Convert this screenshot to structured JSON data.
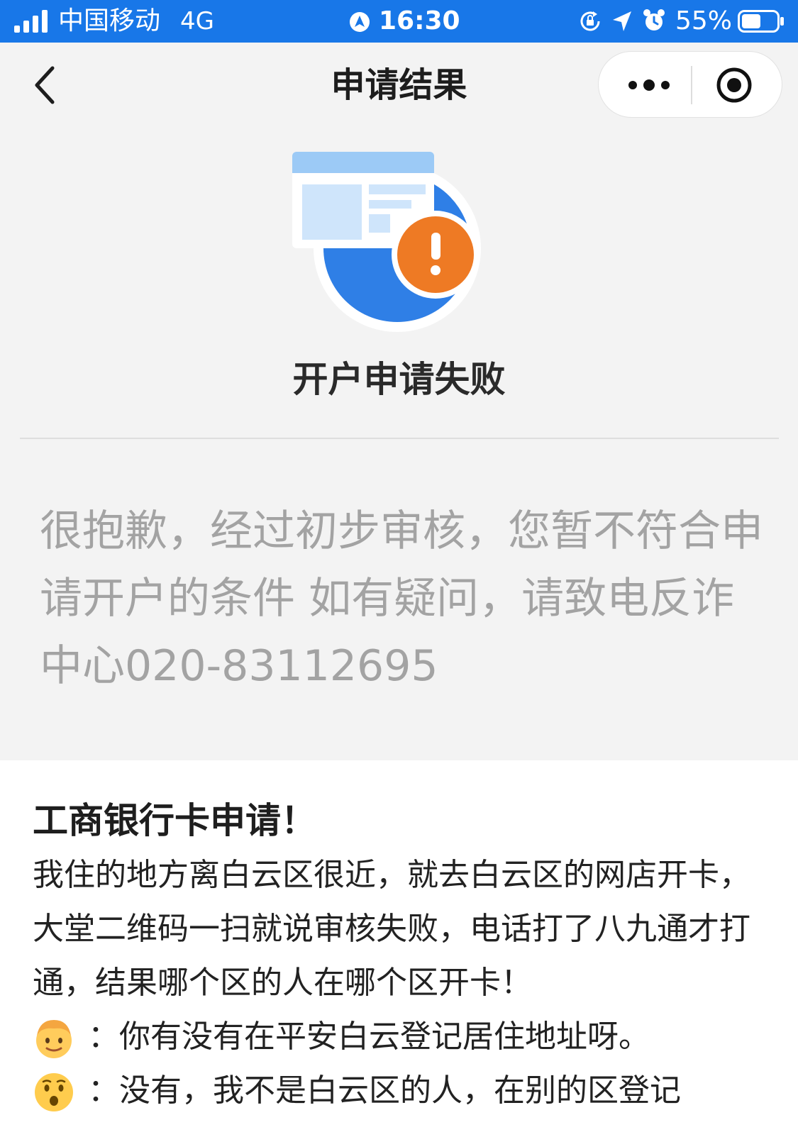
{
  "status_bar": {
    "carrier": "中国移动",
    "network": "4G",
    "time": "16:30",
    "battery_percent": "55%",
    "battery_level": 0.55
  },
  "nav": {
    "title": "申请结果"
  },
  "result": {
    "heading": "开户申请失败",
    "message": "很抱歉，经过初步审核，您暂不符合申请开户的条件 如有疑问，请致电反诈中心020-83112695"
  },
  "post": {
    "title": "工商银行卡申请！",
    "body": "我住的地方离白云区很近，就去白云区的网店开卡，大堂二维码一扫就说审核失败，电话打了八九通才打通，结果哪个区的人在哪个区开卡！",
    "chat": [
      {
        "emoji": "man-face-emoji",
        "text": "：你有没有在平安白云登记居住地址呀。"
      },
      {
        "emoji": "surprised-face-emoji",
        "text": "：没有，我不是白云区的人，在别的区登记"
      }
    ]
  },
  "colors": {
    "status_bar": "#1877e8",
    "page_background": "#f3f3f3",
    "alert_orange": "#ee7a24",
    "illustration_blue": "#2f7fe6",
    "message_gray": "#a3a3a3"
  }
}
